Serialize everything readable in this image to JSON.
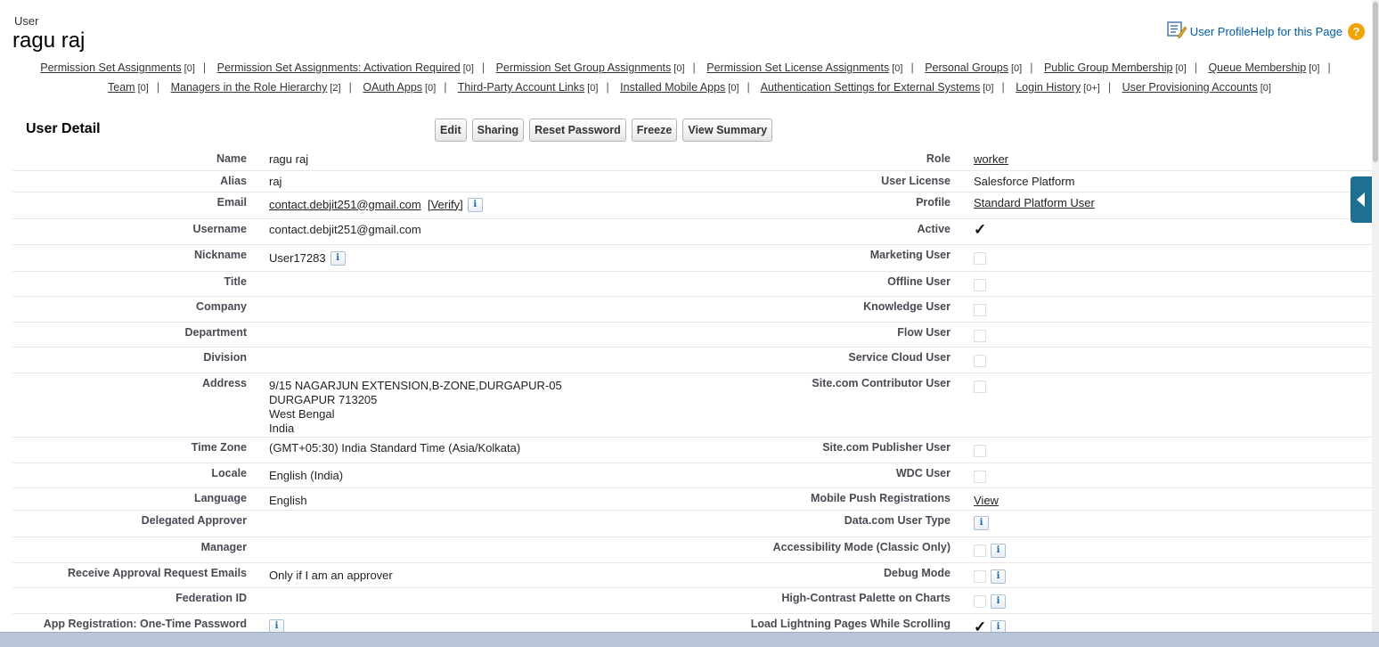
{
  "header": {
    "type_label": "User",
    "title": "ragu raj",
    "profile_help_link": "User ProfileHelp for this Page",
    "help_icon_glyph": "?"
  },
  "related_lists": [
    {
      "label": "Permission Set Assignments",
      "count": "[0]"
    },
    {
      "label": "Permission Set Assignments: Activation Required",
      "count": "[0]"
    },
    {
      "label": "Permission Set Group Assignments",
      "count": "[0]"
    },
    {
      "label": "Permission Set License Assignments",
      "count": "[0]"
    },
    {
      "label": "Personal Groups",
      "count": "[0]"
    },
    {
      "label": "Public Group Membership",
      "count": "[0]"
    },
    {
      "label": "Queue Membership",
      "count": "[0]"
    },
    {
      "label": "Team",
      "count": "[0]"
    },
    {
      "label": "Managers in the Role Hierarchy",
      "count": "[2]"
    },
    {
      "label": "OAuth Apps",
      "count": "[0]"
    },
    {
      "label": "Third-Party Account Links",
      "count": "[0]"
    },
    {
      "label": "Installed Mobile Apps",
      "count": "[0]"
    },
    {
      "label": "Authentication Settings for External Systems",
      "count": "[0]"
    },
    {
      "label": "Login History",
      "count": "[0+]"
    },
    {
      "label": "User Provisioning Accounts",
      "count": "[0]"
    }
  ],
  "section": {
    "title": "User Detail",
    "buttons": {
      "edit": "Edit",
      "sharing": "Sharing",
      "reset_password": "Reset Password",
      "freeze": "Freeze",
      "view_summary": "View Summary"
    }
  },
  "info_glyph": "i",
  "check_glyph": "✓",
  "left": {
    "name": {
      "label": "Name",
      "value": "ragu raj"
    },
    "alias": {
      "label": "Alias",
      "value": "raj"
    },
    "email": {
      "label": "Email",
      "value": "contact.debjit251@gmail.com",
      "verify": "[Verify]"
    },
    "username": {
      "label": "Username",
      "value": "contact.debjit251@gmail.com"
    },
    "nickname": {
      "label": "Nickname",
      "value": "User17283"
    },
    "title": {
      "label": "Title",
      "value": ""
    },
    "company": {
      "label": "Company",
      "value": ""
    },
    "department": {
      "label": "Department",
      "value": ""
    },
    "division": {
      "label": "Division",
      "value": ""
    },
    "address": {
      "label": "Address",
      "line1": "9/15 NAGARJUN EXTENSION,B-ZONE,DURGAPUR-05",
      "line2": "DURGAPUR 713205",
      "line3": "West Bengal",
      "line4": "India"
    },
    "time_zone": {
      "label": "Time Zone",
      "value": "(GMT+05:30) India Standard Time (Asia/Kolkata)"
    },
    "locale": {
      "label": "Locale",
      "value": "English (India)"
    },
    "language": {
      "label": "Language",
      "value": "English"
    },
    "delegated_approver": {
      "label": "Delegated Approver",
      "value": ""
    },
    "manager": {
      "label": "Manager",
      "value": ""
    },
    "receive_approval": {
      "label": "Receive Approval Request Emails",
      "value": "Only if I am an approver"
    },
    "federation_id": {
      "label": "Federation ID",
      "value": ""
    },
    "app_registration": {
      "label": "App Registration: One-Time Password",
      "value": ""
    }
  },
  "right": {
    "role": {
      "label": "Role",
      "value": "worker"
    },
    "user_license": {
      "label": "User License",
      "value": "Salesforce Platform"
    },
    "profile": {
      "label": "Profile",
      "value": "Standard Platform User"
    },
    "active": {
      "label": "Active",
      "checked": true
    },
    "marketing_user": {
      "label": "Marketing User",
      "checked": false
    },
    "offline_user": {
      "label": "Offline User",
      "checked": false
    },
    "knowledge_user": {
      "label": "Knowledge User",
      "checked": false
    },
    "flow_user": {
      "label": "Flow User",
      "checked": false
    },
    "service_cloud_user": {
      "label": "Service Cloud User",
      "checked": false
    },
    "site_contributor": {
      "label": "Site.com Contributor User",
      "checked": false
    },
    "site_publisher": {
      "label": "Site.com Publisher User",
      "checked": false
    },
    "wdc_user": {
      "label": "WDC User",
      "checked": false
    },
    "mobile_push": {
      "label": "Mobile Push Registrations",
      "value": "View"
    },
    "datacom_user_type": {
      "label": "Data.com User Type"
    },
    "accessibility_mode": {
      "label": "Accessibility Mode (Classic Only)",
      "checked": false
    },
    "debug_mode": {
      "label": "Debug Mode",
      "checked": false
    },
    "high_contrast": {
      "label": "High-Contrast Palette on Charts",
      "checked": false
    },
    "load_lightning": {
      "label": "Load Lightning Pages While Scrolling",
      "checked": true
    }
  }
}
